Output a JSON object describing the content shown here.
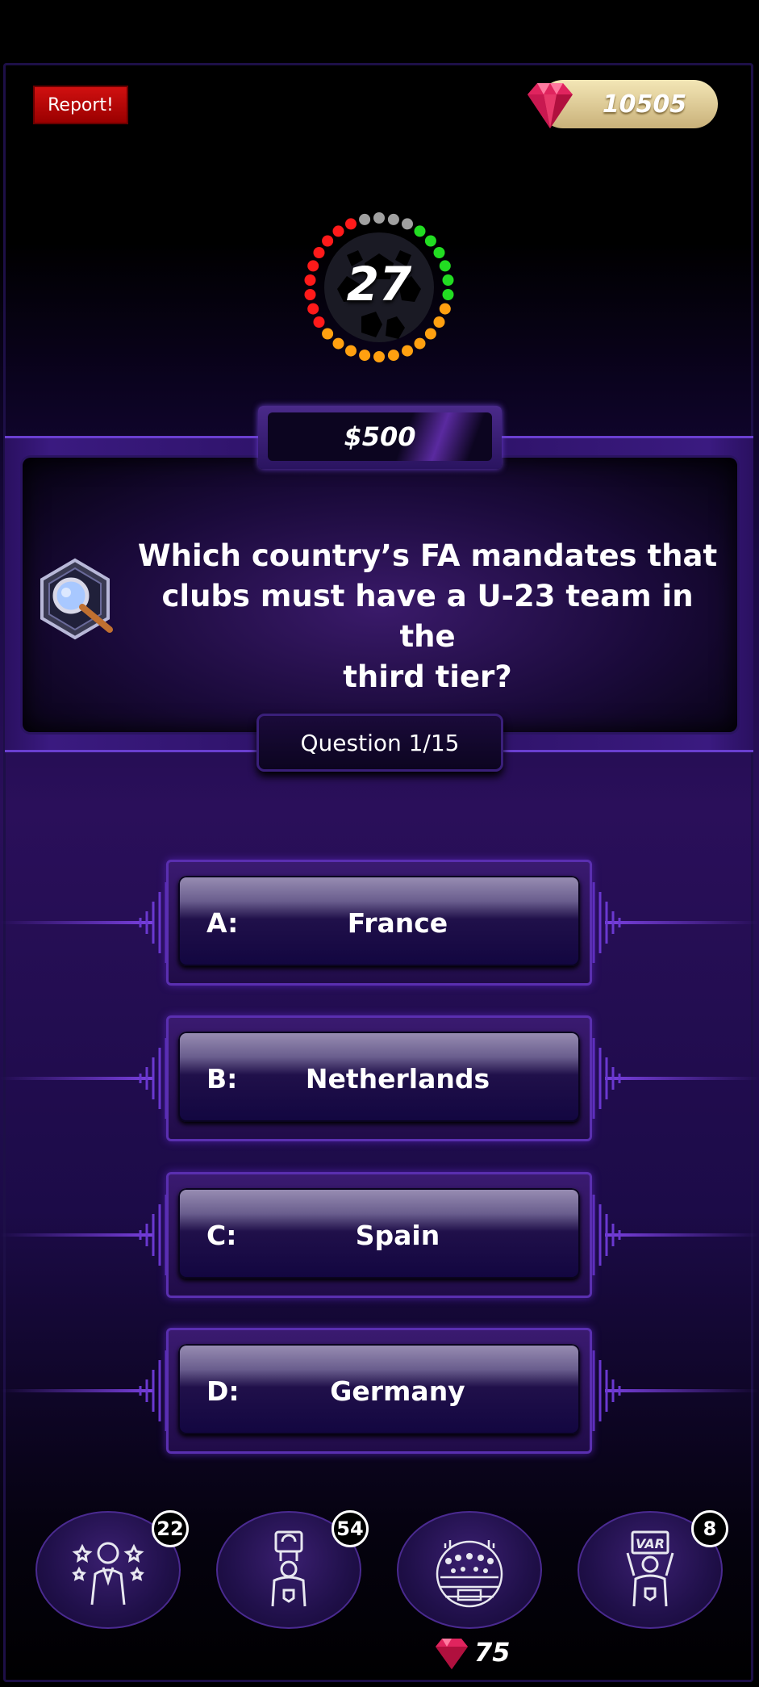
{
  "header": {
    "report_label": "Report!",
    "gems": "10505"
  },
  "timer": {
    "value": "27",
    "colors": {
      "red": "#ff1a1a",
      "grey": "#a0a0a0",
      "green": "#22dd22",
      "orange": "#ffa010"
    }
  },
  "question": {
    "prize": "$500",
    "text_lines": [
      "Which country’s FA mandates that",
      "clubs must have a U-23 team in the",
      "third tier?"
    ],
    "counter": "Question 1/15",
    "icon": "magnifier-icon"
  },
  "answers": [
    {
      "letter": "A:",
      "text": "France"
    },
    {
      "letter": "B:",
      "text": "Netherlands"
    },
    {
      "letter": "C:",
      "text": "Spain"
    },
    {
      "letter": "D:",
      "text": "Germany"
    }
  ],
  "lifelines": [
    {
      "icon": "coach-icon",
      "count": "22"
    },
    {
      "icon": "referee-card-icon",
      "count": "54"
    },
    {
      "icon": "crowd-icon",
      "count": ""
    },
    {
      "icon": "var-referee-icon",
      "count": "8"
    }
  ],
  "lifeline_cost": "75"
}
